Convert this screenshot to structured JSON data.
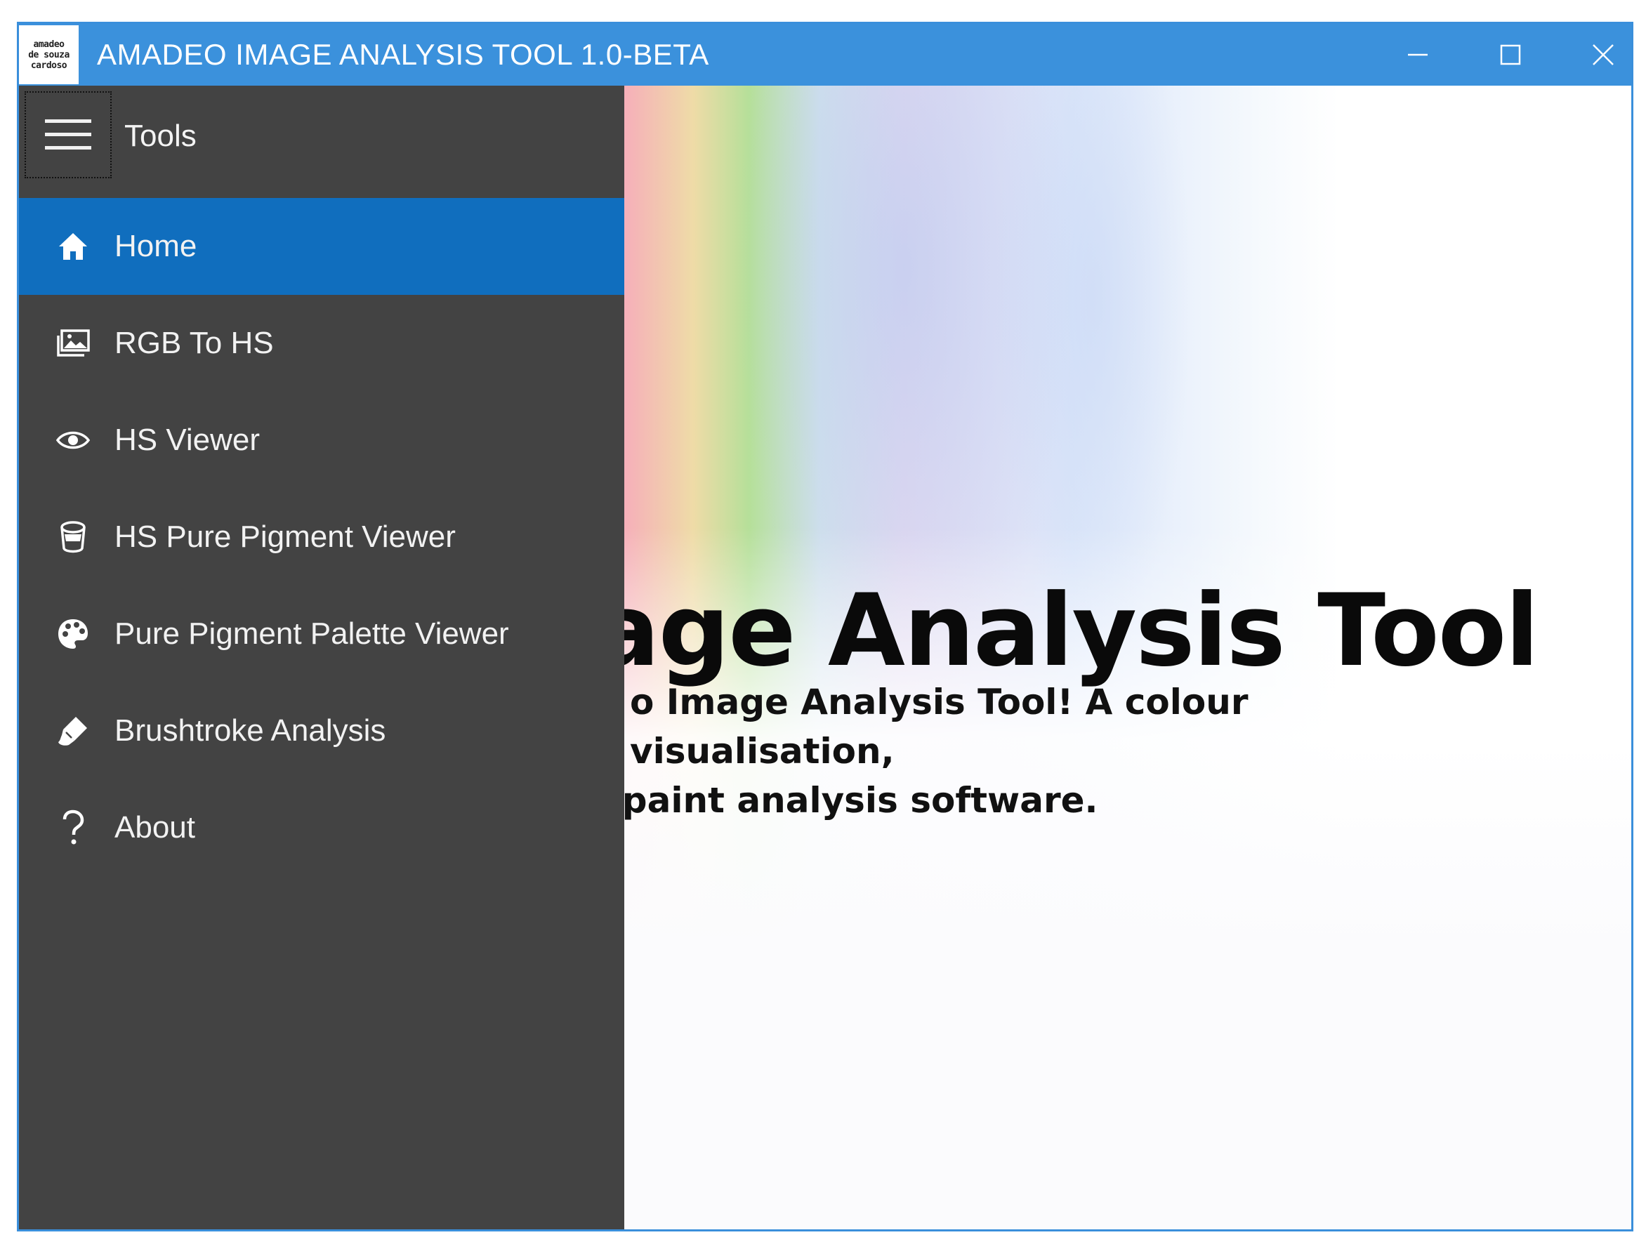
{
  "window": {
    "logo_lines": [
      "amadeo",
      "de souza",
      "cardoso"
    ],
    "title": "AMADEO IMAGE ANALYSIS TOOL 1.0-BETA",
    "controls": [
      "minimize",
      "maximize",
      "close"
    ]
  },
  "sidebar": {
    "title": "Tools",
    "items": [
      {
        "label": "Home",
        "icon": "home-icon",
        "active": true
      },
      {
        "label": "RGB To HS",
        "icon": "image-icon",
        "active": false
      },
      {
        "label": "HS Viewer",
        "icon": "eye-icon",
        "active": false
      },
      {
        "label": "HS Pure Pigment Viewer",
        "icon": "paint-bucket-icon",
        "active": false
      },
      {
        "label": "Pure Pigment Palette Viewer",
        "icon": "palette-icon",
        "active": false
      },
      {
        "label": "Brushtroke Analysis",
        "icon": "brush-icon",
        "active": false
      },
      {
        "label": "About",
        "icon": "help-icon",
        "active": false
      }
    ]
  },
  "main": {
    "title": "Image Analysis Tool",
    "subtitle_line1": "o Image Analysis Tool! A colour visualisation,",
    "subtitle_line2": "nd paint analysis software."
  },
  "colors": {
    "titlebar": "#3b91dc",
    "sidebar": "#434343",
    "active_item": "#106ebe"
  }
}
